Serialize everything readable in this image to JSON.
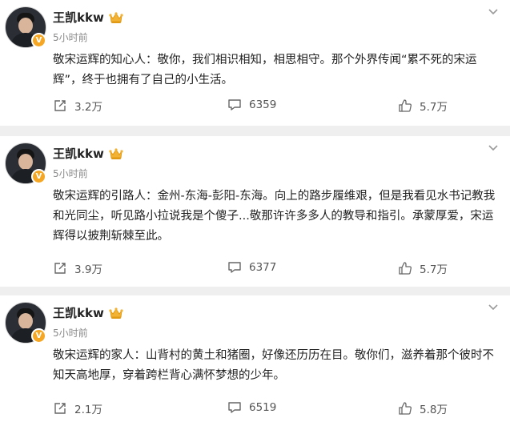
{
  "posts": [
    {
      "username": "王凯kkw",
      "time": "5小时前",
      "avatar_badge": "V",
      "content": "敬宋运辉的知心人：敬你，我们相识相知，相思相守。那个外界传闻“累不死的宋运辉”，终于也拥有了自己的小生活。",
      "shares": "3.2万",
      "comments": "6359",
      "likes": "5.7万"
    },
    {
      "username": "王凯kkw",
      "time": "5小时前",
      "avatar_badge": "V",
      "content": "敬宋运辉的引路人：金州-东海-彭阳-东海。向上的路步履维艰，但是我看见水书记教我和光同尘，听见路小拉说我是个傻子...敬那许许多多人的教导和指引。承蒙厚爱，宋运辉得以披荆斩棘至此。",
      "shares": "3.9万",
      "comments": "6377",
      "likes": "5.7万"
    },
    {
      "username": "王凯kkw",
      "time": "5小时前",
      "avatar_badge": "V",
      "content": "敬宋运辉的家人：山背村的黄土和猪圈，好像还历历在目。敬你们，滋养着那个彼时不知天高地厚，穿着跨栏背心满怀梦想的少年。",
      "shares": "2.1万",
      "comments": "6519",
      "likes": "5.8万"
    }
  ],
  "icons": {
    "verified": "v-badge",
    "member": "crown-icon",
    "more": "chevron-down-icon",
    "share": "share-icon",
    "comment": "comment-icon",
    "like": "thumbs-up-icon"
  },
  "colors": {
    "background": "#efefef",
    "card": "#ffffff",
    "text": "#222222",
    "muted": "#8a8a8a",
    "badge": "#f5a623"
  }
}
